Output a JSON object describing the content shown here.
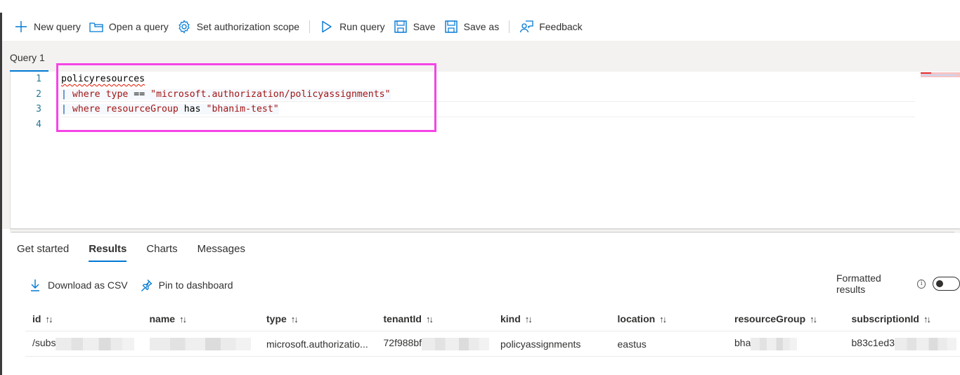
{
  "toolbar": {
    "items": [
      {
        "label": "New query",
        "icon": "plus-icon"
      },
      {
        "label": "Open a query",
        "icon": "folder-icon"
      },
      {
        "label": "Set authorization scope",
        "icon": "gear-icon"
      },
      {
        "label": "Run query",
        "icon": "play-icon"
      },
      {
        "label": "Save",
        "icon": "save-icon"
      },
      {
        "label": "Save as",
        "icon": "save-as-icon"
      },
      {
        "label": "Feedback",
        "icon": "feedback-icon"
      }
    ]
  },
  "query_tab": {
    "label": "Query 1"
  },
  "editor": {
    "line_numbers": [
      "1",
      "2",
      "3",
      "4"
    ],
    "lines": [
      {
        "text": "policyresources"
      },
      {
        "pipe": "|",
        "kw1": "where",
        "field": "type",
        "op": "==",
        "value": "\"microsoft.authorization/policyassignments\""
      },
      {
        "pipe": "|",
        "kw1": "where",
        "field": "resourceGroup",
        "op": "has",
        "value": "\"bhanim-test\""
      },
      {
        "text": ""
      }
    ]
  },
  "results_tabs": [
    {
      "label": "Get started",
      "active": false
    },
    {
      "label": "Results",
      "active": true
    },
    {
      "label": "Charts",
      "active": false
    },
    {
      "label": "Messages",
      "active": false
    }
  ],
  "results_actions": {
    "download": "Download as CSV",
    "pin": "Pin to dashboard"
  },
  "formatted_results": {
    "label": "Formatted results",
    "enabled": false
  },
  "grid": {
    "columns": [
      "id",
      "name",
      "type",
      "tenantId",
      "kind",
      "location",
      "resourceGroup",
      "subscriptionId"
    ],
    "sort_glyph": "↑↓",
    "rows": [
      {
        "id": "/subs",
        "name": "",
        "type": "microsoft.authorizatio...",
        "tenantId": "72f988bf",
        "kind": "policyassignments",
        "location": "eastus",
        "resourceGroup": "bha",
        "subscriptionId": "b83c1ed3"
      }
    ]
  },
  "colors": {
    "accent": "#0078d4",
    "highlight_box": "#f545e6",
    "keyword": "#a31515"
  }
}
